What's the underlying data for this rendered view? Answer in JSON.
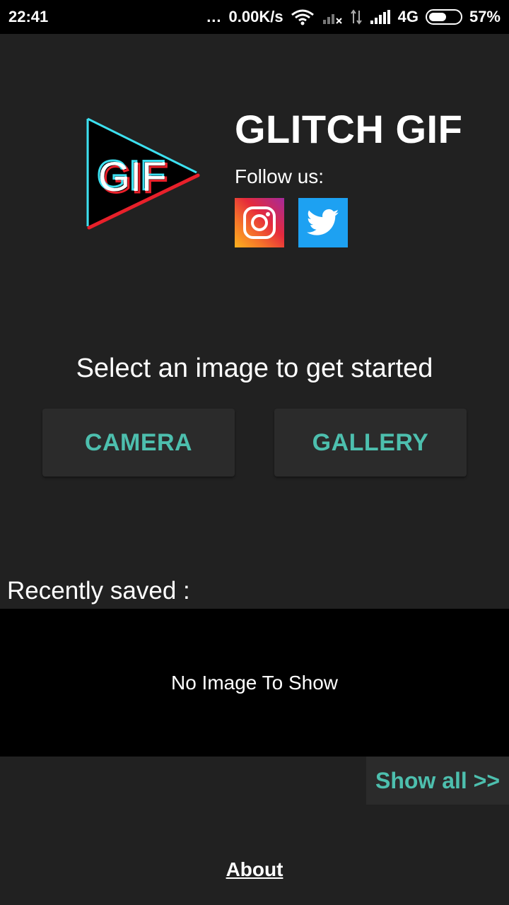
{
  "status_bar": {
    "time": "22:41",
    "dots": "...",
    "speed": "0.00K/s",
    "network": "4G",
    "battery": "57%",
    "battery_level": 0.57
  },
  "app": {
    "title": "GLITCH GIF",
    "logo_text": "GIF",
    "follow_label": "Follow us:"
  },
  "main": {
    "prompt": "Select an image to get started",
    "camera_label": "CAMERA",
    "gallery_label": "GALLERY"
  },
  "recent": {
    "label": "Recently saved :",
    "empty_text": "No Image To Show",
    "show_all_label": "Show all >>"
  },
  "footer": {
    "about_label": "About"
  },
  "colors": {
    "accent": "#4dbfae",
    "background": "#212121",
    "button_bg": "#2b2b2b",
    "twitter": "#1da1f2"
  },
  "icons": {
    "social_1": "instagram-icon",
    "social_2": "twitter-icon"
  }
}
